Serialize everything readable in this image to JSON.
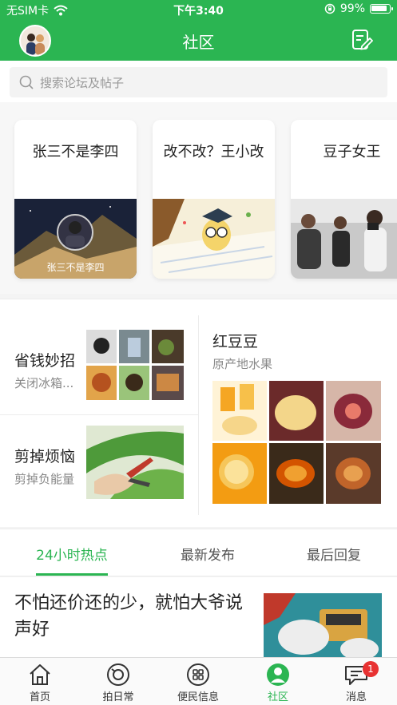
{
  "status_bar": {
    "carrier": "无SIM卡",
    "time": "下午3:40",
    "battery": "99%"
  },
  "header": {
    "title": "社区"
  },
  "search": {
    "placeholder": "搜索论坛及帖子"
  },
  "forums": [
    {
      "title": "张三不是李四",
      "caption": "张三不是李四"
    },
    {
      "title": "改不改？王小改",
      "caption": ""
    },
    {
      "title": "豆子女王",
      "caption": ""
    }
  ],
  "features": {
    "left": [
      {
        "title": "省钱妙招",
        "subtitle": "关闭冰箱..."
      },
      {
        "title": "剪掉烦恼",
        "subtitle": "剪掉负能量"
      }
    ],
    "right": {
      "title": "红豆豆",
      "subtitle": "原产地水果"
    }
  },
  "tabs": [
    {
      "label": "24小时热点",
      "active": true
    },
    {
      "label": "最新发布",
      "active": false
    },
    {
      "label": "最后回复",
      "active": false
    }
  ],
  "post": {
    "title": "不怕还价还的少，就怕大爷说声好"
  },
  "tabbar": [
    {
      "label": "首页",
      "icon": "home-icon"
    },
    {
      "label": "拍日常",
      "icon": "camera-icon"
    },
    {
      "label": "便民信息",
      "icon": "grid-icon"
    },
    {
      "label": "社区",
      "icon": "community-icon",
      "active": true
    },
    {
      "label": "消息",
      "icon": "message-icon",
      "badge": "1"
    }
  ],
  "colors": {
    "brand_green": "#2bb552",
    "badge_red": "#e83232"
  }
}
